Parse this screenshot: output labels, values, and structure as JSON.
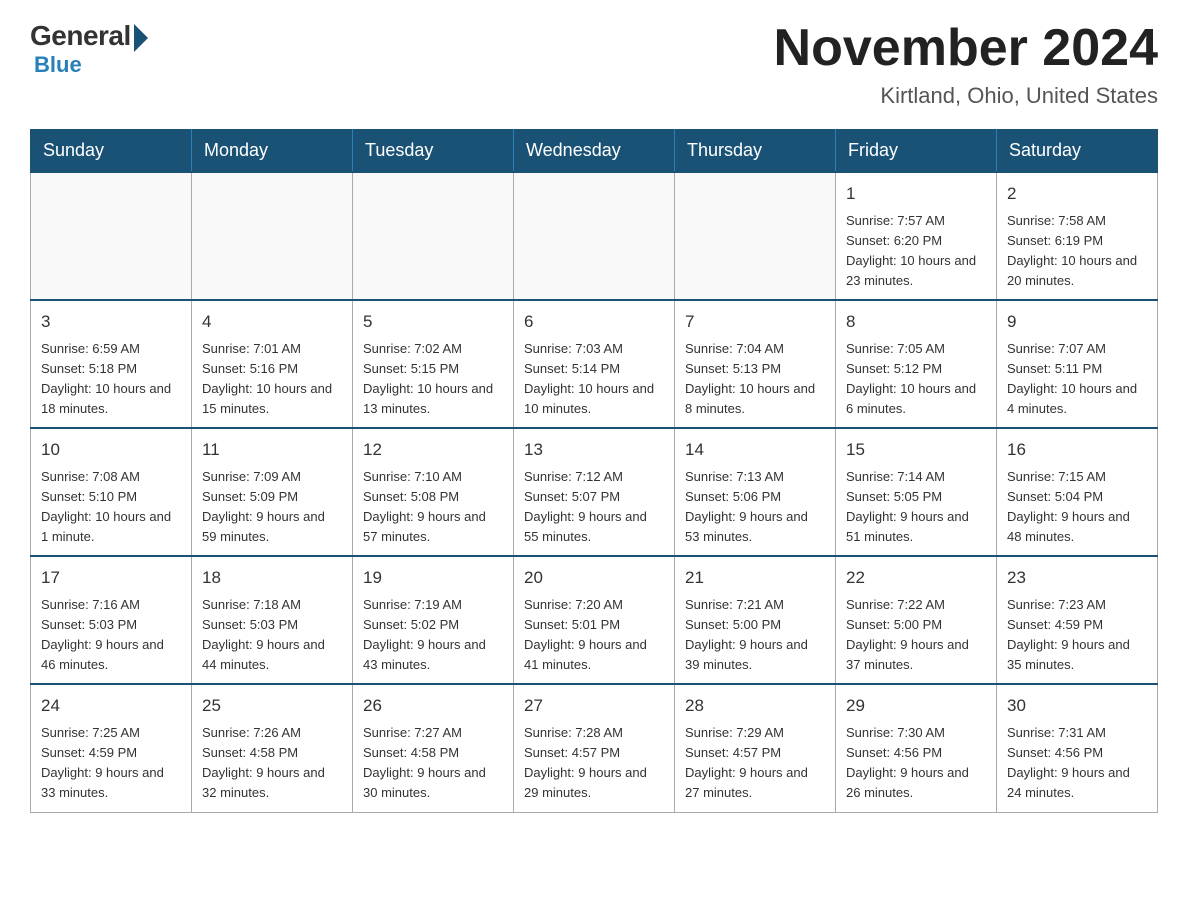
{
  "header": {
    "logo": {
      "general": "General",
      "blue": "Blue"
    },
    "title": "November 2024",
    "location": "Kirtland, Ohio, United States"
  },
  "days_of_week": [
    "Sunday",
    "Monday",
    "Tuesday",
    "Wednesday",
    "Thursday",
    "Friday",
    "Saturday"
  ],
  "weeks": [
    [
      {
        "day": "",
        "info": ""
      },
      {
        "day": "",
        "info": ""
      },
      {
        "day": "",
        "info": ""
      },
      {
        "day": "",
        "info": ""
      },
      {
        "day": "",
        "info": ""
      },
      {
        "day": "1",
        "info": "Sunrise: 7:57 AM\nSunset: 6:20 PM\nDaylight: 10 hours and 23 minutes."
      },
      {
        "day": "2",
        "info": "Sunrise: 7:58 AM\nSunset: 6:19 PM\nDaylight: 10 hours and 20 minutes."
      }
    ],
    [
      {
        "day": "3",
        "info": "Sunrise: 6:59 AM\nSunset: 5:18 PM\nDaylight: 10 hours and 18 minutes."
      },
      {
        "day": "4",
        "info": "Sunrise: 7:01 AM\nSunset: 5:16 PM\nDaylight: 10 hours and 15 minutes."
      },
      {
        "day": "5",
        "info": "Sunrise: 7:02 AM\nSunset: 5:15 PM\nDaylight: 10 hours and 13 minutes."
      },
      {
        "day": "6",
        "info": "Sunrise: 7:03 AM\nSunset: 5:14 PM\nDaylight: 10 hours and 10 minutes."
      },
      {
        "day": "7",
        "info": "Sunrise: 7:04 AM\nSunset: 5:13 PM\nDaylight: 10 hours and 8 minutes."
      },
      {
        "day": "8",
        "info": "Sunrise: 7:05 AM\nSunset: 5:12 PM\nDaylight: 10 hours and 6 minutes."
      },
      {
        "day": "9",
        "info": "Sunrise: 7:07 AM\nSunset: 5:11 PM\nDaylight: 10 hours and 4 minutes."
      }
    ],
    [
      {
        "day": "10",
        "info": "Sunrise: 7:08 AM\nSunset: 5:10 PM\nDaylight: 10 hours and 1 minute."
      },
      {
        "day": "11",
        "info": "Sunrise: 7:09 AM\nSunset: 5:09 PM\nDaylight: 9 hours and 59 minutes."
      },
      {
        "day": "12",
        "info": "Sunrise: 7:10 AM\nSunset: 5:08 PM\nDaylight: 9 hours and 57 minutes."
      },
      {
        "day": "13",
        "info": "Sunrise: 7:12 AM\nSunset: 5:07 PM\nDaylight: 9 hours and 55 minutes."
      },
      {
        "day": "14",
        "info": "Sunrise: 7:13 AM\nSunset: 5:06 PM\nDaylight: 9 hours and 53 minutes."
      },
      {
        "day": "15",
        "info": "Sunrise: 7:14 AM\nSunset: 5:05 PM\nDaylight: 9 hours and 51 minutes."
      },
      {
        "day": "16",
        "info": "Sunrise: 7:15 AM\nSunset: 5:04 PM\nDaylight: 9 hours and 48 minutes."
      }
    ],
    [
      {
        "day": "17",
        "info": "Sunrise: 7:16 AM\nSunset: 5:03 PM\nDaylight: 9 hours and 46 minutes."
      },
      {
        "day": "18",
        "info": "Sunrise: 7:18 AM\nSunset: 5:03 PM\nDaylight: 9 hours and 44 minutes."
      },
      {
        "day": "19",
        "info": "Sunrise: 7:19 AM\nSunset: 5:02 PM\nDaylight: 9 hours and 43 minutes."
      },
      {
        "day": "20",
        "info": "Sunrise: 7:20 AM\nSunset: 5:01 PM\nDaylight: 9 hours and 41 minutes."
      },
      {
        "day": "21",
        "info": "Sunrise: 7:21 AM\nSunset: 5:00 PM\nDaylight: 9 hours and 39 minutes."
      },
      {
        "day": "22",
        "info": "Sunrise: 7:22 AM\nSunset: 5:00 PM\nDaylight: 9 hours and 37 minutes."
      },
      {
        "day": "23",
        "info": "Sunrise: 7:23 AM\nSunset: 4:59 PM\nDaylight: 9 hours and 35 minutes."
      }
    ],
    [
      {
        "day": "24",
        "info": "Sunrise: 7:25 AM\nSunset: 4:59 PM\nDaylight: 9 hours and 33 minutes."
      },
      {
        "day": "25",
        "info": "Sunrise: 7:26 AM\nSunset: 4:58 PM\nDaylight: 9 hours and 32 minutes."
      },
      {
        "day": "26",
        "info": "Sunrise: 7:27 AM\nSunset: 4:58 PM\nDaylight: 9 hours and 30 minutes."
      },
      {
        "day": "27",
        "info": "Sunrise: 7:28 AM\nSunset: 4:57 PM\nDaylight: 9 hours and 29 minutes."
      },
      {
        "day": "28",
        "info": "Sunrise: 7:29 AM\nSunset: 4:57 PM\nDaylight: 9 hours and 27 minutes."
      },
      {
        "day": "29",
        "info": "Sunrise: 7:30 AM\nSunset: 4:56 PM\nDaylight: 9 hours and 26 minutes."
      },
      {
        "day": "30",
        "info": "Sunrise: 7:31 AM\nSunset: 4:56 PM\nDaylight: 9 hours and 24 minutes."
      }
    ]
  ]
}
